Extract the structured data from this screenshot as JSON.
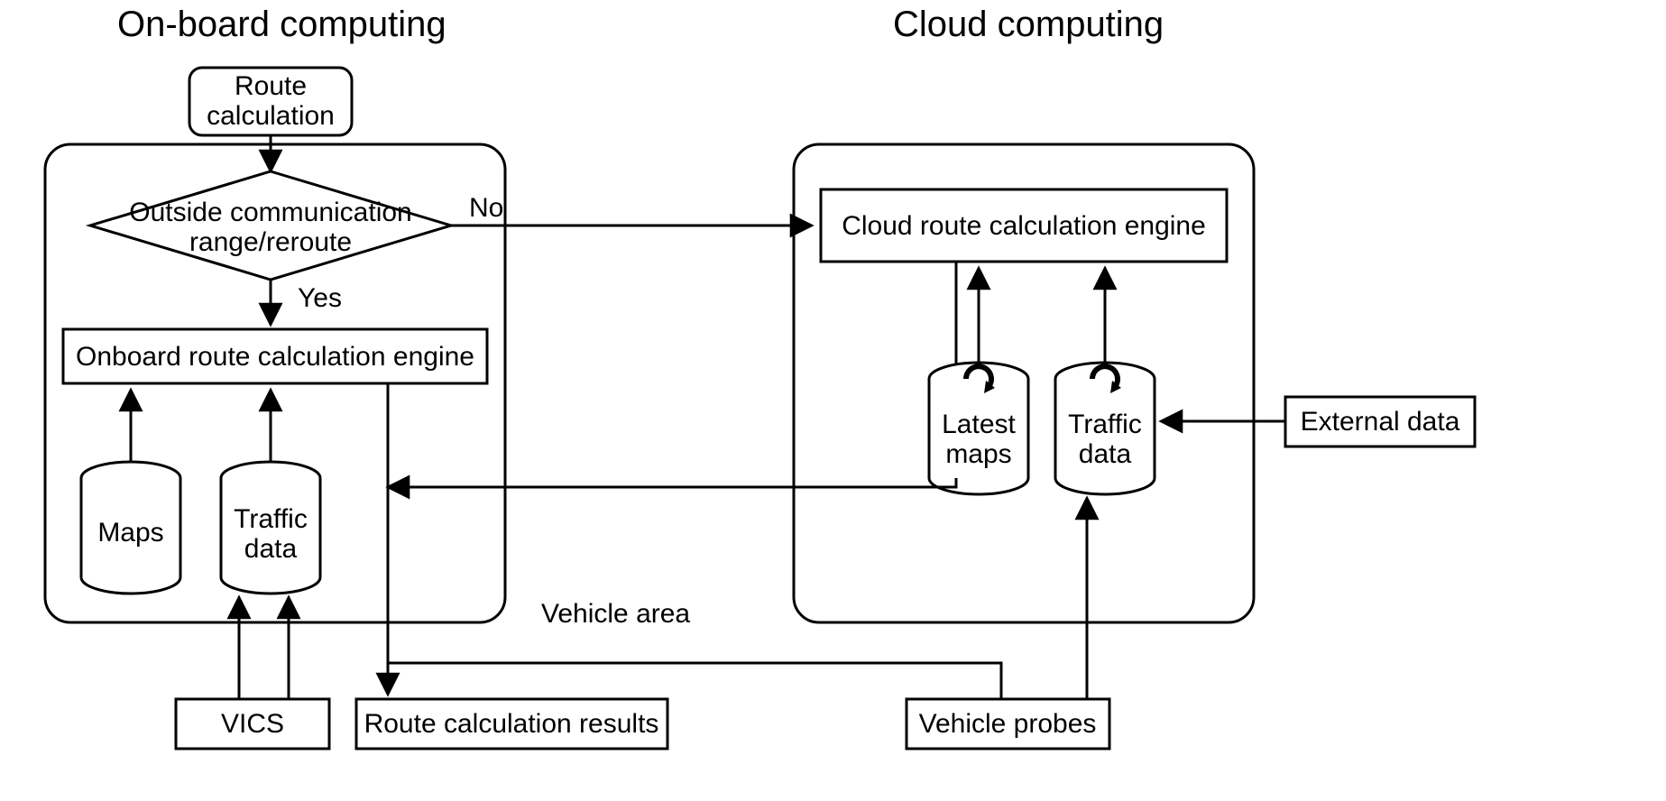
{
  "titles": {
    "onboard": "On-board computing",
    "cloud": "Cloud computing"
  },
  "nodes": {
    "route_calc": {
      "l1": "Route",
      "l2": "calculation"
    },
    "decision": {
      "l1": "Outside communication",
      "l2": "range/reroute"
    },
    "onboard_engine": "Onboard route calculation engine",
    "cloud_engine": "Cloud route calculation engine",
    "maps": "Maps",
    "traffic_onboard": {
      "l1": "Traffic",
      "l2": "data"
    },
    "latest_maps": {
      "l1": "Latest",
      "l2": "maps"
    },
    "traffic_cloud": {
      "l1": "Traffic",
      "l2": "data"
    },
    "vics": "VICS",
    "results": "Route calculation results",
    "vehicle_probes": "Vehicle probes",
    "external_data": "External data",
    "vehicle_area": "Vehicle area"
  },
  "edges": {
    "yes": "Yes",
    "no": "No"
  }
}
